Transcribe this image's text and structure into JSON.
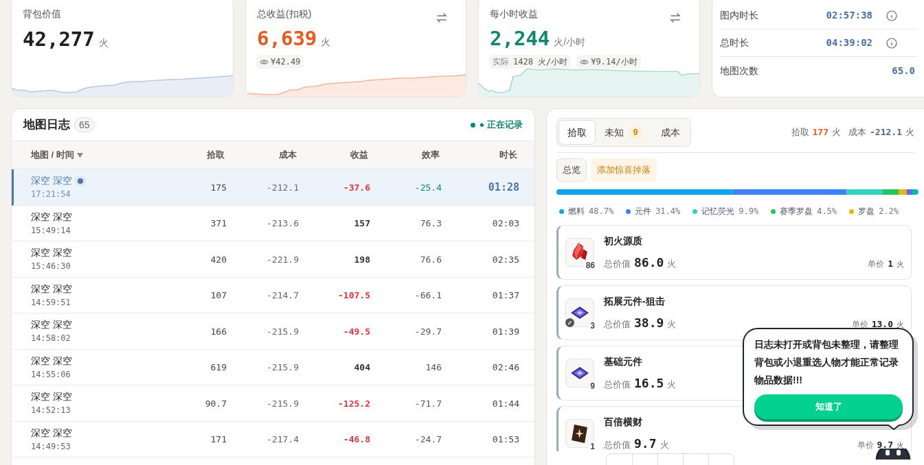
{
  "stats": [
    {
      "kind": "value",
      "title": "背包价值",
      "value": "42,277",
      "unit": "火",
      "color": "#1f1f1f",
      "swap": false
    },
    {
      "kind": "value",
      "title": "总收益(扣税)",
      "value": "6,639",
      "unit": "火",
      "color": "#e8591f",
      "swap": true,
      "chips": [
        {
          "eye": true,
          "text": "¥42.49"
        }
      ]
    },
    {
      "kind": "value",
      "title": "每小时收益",
      "value": "2,244",
      "unit": "火/小时",
      "color": "#12876f",
      "swap": true,
      "chips": [
        {
          "eye": false,
          "label": "实际",
          "text": "1428 火/小时"
        },
        {
          "eye": true,
          "text": "¥9.14/小时"
        }
      ]
    },
    {
      "kind": "list",
      "rows": [
        {
          "label": "图内时长",
          "value": "02:57:38",
          "info": true
        },
        {
          "label": "总时长",
          "value": "04:39:02",
          "info": true
        },
        {
          "label": "地图次数",
          "value": "65.0",
          "info": false
        }
      ]
    }
  ],
  "log": {
    "title": "地图日志",
    "count": "65",
    "status": "● 正在记录",
    "recording": true,
    "columns": [
      "地图 / 时间",
      "拾取",
      "成本",
      "收益",
      "效率",
      "时长"
    ],
    "rows": [
      {
        "map": "深空 深空",
        "time": "17:21:54",
        "pickup": "175",
        "cost": "-212.1",
        "profit": "-37.6",
        "efficiency": "-25.4",
        "duration": "01:28",
        "selected": true,
        "loss": true
      },
      {
        "map": "深空 深空",
        "time": "15:49:14",
        "pickup": "371",
        "cost": "-213.6",
        "profit": "157",
        "efficiency": "76.3",
        "duration": "02:03",
        "selected": false,
        "loss": false
      },
      {
        "map": "深空 深空",
        "time": "15:46:30",
        "pickup": "420",
        "cost": "-221.9",
        "profit": "198",
        "efficiency": "76.6",
        "duration": "02:35",
        "selected": false,
        "loss": false
      },
      {
        "map": "深空 深空",
        "time": "14:59:51",
        "pickup": "107",
        "cost": "-214.7",
        "profit": "-107.5",
        "efficiency": "-66.1",
        "duration": "01:37",
        "selected": false,
        "loss": true
      },
      {
        "map": "深空 深空",
        "time": "14:58:02",
        "pickup": "166",
        "cost": "-215.9",
        "profit": "-49.5",
        "efficiency": "-29.7",
        "duration": "01:39",
        "selected": false,
        "loss": true
      },
      {
        "map": "深空 深空",
        "time": "14:55:06",
        "pickup": "619",
        "cost": "-215.9",
        "profit": "404",
        "efficiency": "146",
        "duration": "02:46",
        "selected": false,
        "loss": false
      },
      {
        "map": "深空 深空",
        "time": "14:52:13",
        "pickup": "90.7",
        "cost": "-215.9",
        "profit": "-125.2",
        "efficiency": "-71.7",
        "duration": "01:44",
        "selected": false,
        "loss": true
      },
      {
        "map": "深空 深空",
        "time": "14:49:53",
        "pickup": "171",
        "cost": "-217.4",
        "profit": "-46.8",
        "efficiency": "-24.7",
        "duration": "01:53",
        "selected": false,
        "loss": true
      }
    ]
  },
  "detail": {
    "tabs": [
      {
        "label": "拾取",
        "selected": true
      },
      {
        "label": "未知",
        "badge": "9",
        "selected": false
      },
      {
        "label": "成本",
        "selected": false
      }
    ],
    "summary": {
      "pickup_label": "拾取",
      "pickup": "177",
      "pickup_unit": "火",
      "cost_label": "成本",
      "cost": "-212.1",
      "cost_unit": "火"
    },
    "filters": [
      {
        "label": "总览",
        "kind": "plain"
      },
      {
        "label": "添加惊喜掉落",
        "kind": "accent"
      }
    ],
    "legend": [
      {
        "label": "燃料",
        "pct": "48.7%",
        "color": "#0ea5e9"
      },
      {
        "label": "元件",
        "pct": "31.4%",
        "color": "#3b82f6"
      },
      {
        "label": "记忆荧光",
        "pct": "9.9%",
        "color": "#2dd4bf"
      },
      {
        "label": "赛季罗盘",
        "pct": "4.5%",
        "color": "#22c55e"
      },
      {
        "label": "罗盘",
        "pct": "2.2%",
        "color": "#eab308"
      }
    ],
    "items": [
      {
        "name": "初火源质",
        "qty": "86",
        "total_label": "总价值",
        "total": "86.0",
        "unit": "火",
        "price_label": "单价",
        "price": "1",
        "price_unit": "火"
      },
      {
        "name": "拓展元件-狙击",
        "qty": "3",
        "total_label": "总价值",
        "total": "38.9",
        "unit": "火",
        "price_label": "单价",
        "price": "13.0",
        "price_unit": "火"
      },
      {
        "name": "基础元件",
        "qty": "9",
        "total_label": "总价值",
        "total": "16.5",
        "unit": "火"
      },
      {
        "name": "百倍横财",
        "qty": "1",
        "total_label": "总价值",
        "total": "9.7",
        "unit": "火",
        "price_label": "单价",
        "price": "9.7",
        "price_unit": "火"
      }
    ]
  },
  "tooltip": {
    "text": "日志未打开或背包未整理，请整理背包或小退重选人物才能正常记录物品数据!!!",
    "button": "知道了"
  }
}
